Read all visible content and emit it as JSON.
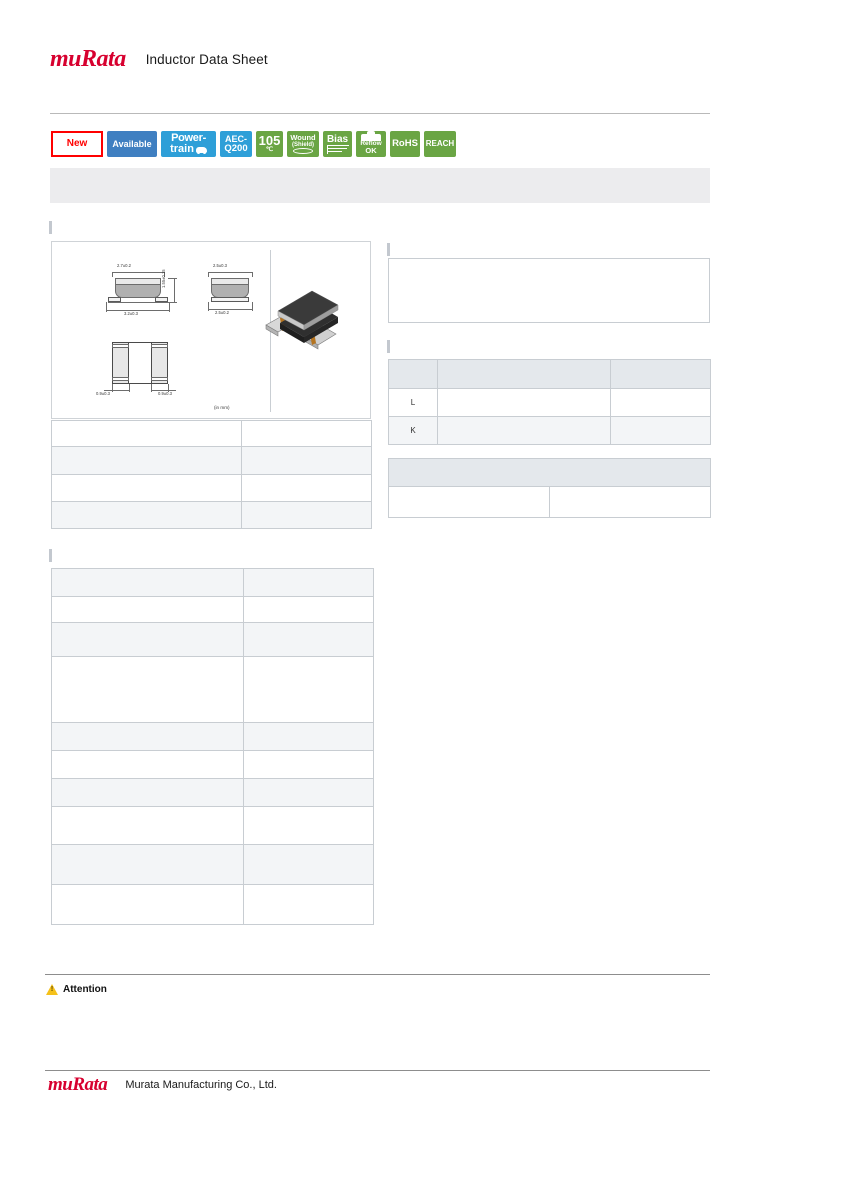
{
  "document": {
    "header_title": "Inductor Data Sheet",
    "logo_text": "muRata",
    "logo_cap_m": "m",
    "logo_rest": "uRata"
  },
  "badges": [
    {
      "id": "new",
      "label": "New",
      "style": "new",
      "lines": [
        "New"
      ]
    },
    {
      "id": "available",
      "label": "Available",
      "style": "blue",
      "lines": [
        "Available"
      ]
    },
    {
      "id": "powertrain",
      "label": "Power-train",
      "style": "lblue",
      "lines": [
        "Power-",
        "train"
      ]
    },
    {
      "id": "aec-q200",
      "label": "AEC-Q200",
      "style": "lblue",
      "lines": [
        "AEC-",
        "Q200"
      ]
    },
    {
      "id": "temp-105",
      "label": "105 degC",
      "style": "green",
      "lines": [
        "105",
        "℃"
      ]
    },
    {
      "id": "wound-shield",
      "label": "Wound (Shield)",
      "style": "green",
      "lines": [
        "Wound",
        "(Shield)"
      ]
    },
    {
      "id": "bias",
      "label": "Bias",
      "style": "green",
      "lines": [
        "Bias"
      ]
    },
    {
      "id": "reflow-ok",
      "label": "Reflow OK",
      "style": "green",
      "lines": [
        "Reflow",
        "OK"
      ]
    },
    {
      "id": "rohs",
      "label": "RoHS",
      "style": "green",
      "lines": [
        "RoHS"
      ]
    },
    {
      "id": "reach",
      "label": "REACH",
      "style": "green",
      "lines": [
        "REACH"
      ]
    }
  ],
  "title_banner": {
    "text": ""
  },
  "drawing": {
    "unit_note": "(in mm)",
    "dimensions": {
      "front_top_width": "2.7±0.2",
      "front_bottom_width": "3.2±0.3",
      "front_height": "1.55±0.15",
      "side_top_width": "2.5±0.3",
      "side_bottom_width": "2.5±0.2",
      "pad_left": "0.9±0.3",
      "pad_right": "0.9±0.3"
    }
  },
  "tables": {
    "dimensions": {
      "rows": [
        {
          "label": "",
          "value": ""
        },
        {
          "label": "",
          "value": ""
        },
        {
          "label": "",
          "value": ""
        },
        {
          "label": "",
          "value": ""
        }
      ]
    },
    "shape_note": {
      "text": ""
    },
    "lk": {
      "headers": [
        "",
        "",
        ""
      ],
      "rows": [
        {
          "code": "L",
          "description": "",
          "value": ""
        },
        {
          "code": "K",
          "description": "",
          "value": ""
        }
      ]
    },
    "packaging": {
      "header": "",
      "rows": [
        {
          "label": "",
          "value": ""
        }
      ]
    },
    "spec": {
      "rows": [
        {
          "label": "",
          "value": ""
        },
        {
          "label": "",
          "value": ""
        },
        {
          "label": "",
          "value": ""
        },
        {
          "label": "",
          "value": ""
        },
        {
          "label": "",
          "value": ""
        },
        {
          "label": "",
          "value": ""
        },
        {
          "label": "",
          "value": ""
        },
        {
          "label": "",
          "value": ""
        },
        {
          "label": "",
          "value": ""
        },
        {
          "label": "",
          "value": ""
        }
      ]
    }
  },
  "attention": {
    "label": "Attention",
    "body": ""
  },
  "footer": {
    "company": "Murata Manufacturing Co., Ltd."
  },
  "colors": {
    "brand_red": "#d7002f",
    "badge_blue": "#3f7fc1",
    "badge_lightblue": "#2e9fd8",
    "badge_green": "#6aa544",
    "badge_new_border": "#ff0000",
    "banner_grey": "#ececee",
    "table_header": "#e4e8ec",
    "table_alt": "#f3f5f7",
    "table_border": "#c8cdd2",
    "warning_yellow": "#f5c11a"
  }
}
